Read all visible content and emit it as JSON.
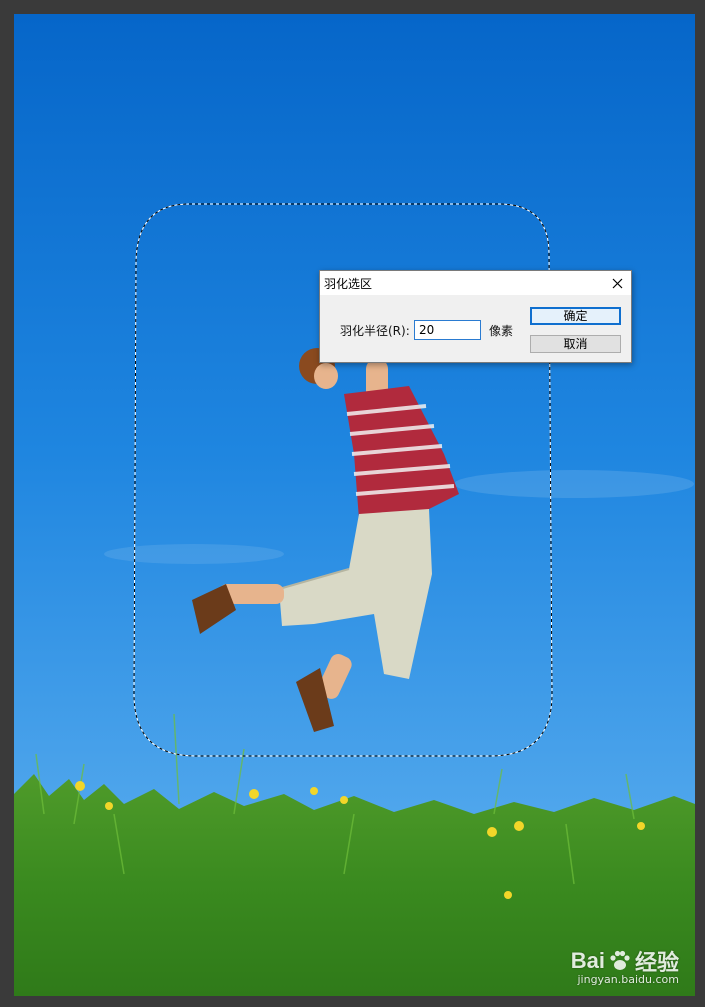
{
  "dialog": {
    "title": "羽化选区",
    "radius_label": "羽化半径(R):",
    "radius_value": "20",
    "unit_label": "像素",
    "ok_label": "确定",
    "cancel_label": "取消",
    "close_icon": "close-icon"
  },
  "watermark": {
    "brand": "Bai",
    "brand_suffix": "经验",
    "url": "jingyan.baidu.com"
  },
  "colors": {
    "sky_top": "#0a6bcb",
    "sky_bottom": "#4aa3ea",
    "grass": "#3f8f22",
    "workspace": "#3a3a3a",
    "accent": "#0f6fcf"
  }
}
